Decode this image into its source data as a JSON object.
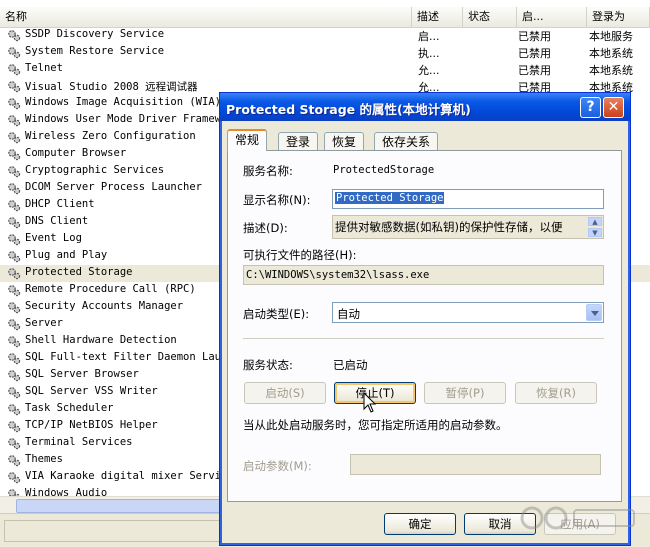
{
  "columns": {
    "name": "名称",
    "desc": "描述",
    "status": "状态",
    "startup": "启...",
    "logon": "登录为"
  },
  "services": [
    {
      "name": "SSDP Discovery Service",
      "desc": "启...",
      "status": "",
      "startup": "已禁用",
      "logon": "本地服务"
    },
    {
      "name": "System Restore Service",
      "desc": "执...",
      "status": "",
      "startup": "已禁用",
      "logon": "本地系统"
    },
    {
      "name": "Telnet",
      "desc": "允...",
      "status": "",
      "startup": "已禁用",
      "logon": "本地系统"
    },
    {
      "name": "Visual Studio 2008 远程调试器",
      "desc": "允...",
      "status": "",
      "startup": "已禁用",
      "logon": "本地系统"
    },
    {
      "name": "Windows Image Acquisition (WIA)",
      "desc": "",
      "status": "",
      "startup": "",
      "logon": ""
    },
    {
      "name": "Windows User Mode Driver Framework",
      "desc": "",
      "status": "",
      "startup": "",
      "logon": ""
    },
    {
      "name": "Wireless Zero Configuration",
      "desc": "",
      "status": "",
      "startup": "",
      "logon": ""
    },
    {
      "name": "Computer Browser",
      "desc": "",
      "status": "",
      "startup": "",
      "logon": ""
    },
    {
      "name": "Cryptographic Services",
      "desc": "",
      "status": "",
      "startup": "",
      "logon": ""
    },
    {
      "name": "DCOM Server Process Launcher",
      "desc": "",
      "status": "",
      "startup": "",
      "logon": ""
    },
    {
      "name": "DHCP Client",
      "desc": "",
      "status": "",
      "startup": "",
      "logon": ""
    },
    {
      "name": "DNS Client",
      "desc": "",
      "status": "",
      "startup": "",
      "logon": ""
    },
    {
      "name": "Event Log",
      "desc": "",
      "status": "",
      "startup": "",
      "logon": ""
    },
    {
      "name": "Plug and Play",
      "desc": "",
      "status": "",
      "startup": "",
      "logon": ""
    },
    {
      "name": "Protected Storage",
      "desc": "",
      "status": "",
      "startup": "",
      "logon": "",
      "selected": true
    },
    {
      "name": "Remote Procedure Call (RPC)",
      "desc": "",
      "status": "",
      "startup": "",
      "logon": ""
    },
    {
      "name": "Security Accounts Manager",
      "desc": "",
      "status": "",
      "startup": "",
      "logon": ""
    },
    {
      "name": "Server",
      "desc": "",
      "status": "",
      "startup": "",
      "logon": ""
    },
    {
      "name": "Shell Hardware Detection",
      "desc": "",
      "status": "",
      "startup": "",
      "logon": ""
    },
    {
      "name": "SQL Full-text Filter Daemon Launcher",
      "desc": "",
      "status": "",
      "startup": "",
      "logon": ""
    },
    {
      "name": "SQL Server Browser",
      "desc": "",
      "status": "",
      "startup": "",
      "logon": ""
    },
    {
      "name": "SQL Server VSS Writer",
      "desc": "",
      "status": "",
      "startup": "",
      "logon": ""
    },
    {
      "name": "Task Scheduler",
      "desc": "",
      "status": "",
      "startup": "",
      "logon": ""
    },
    {
      "name": "TCP/IP NetBIOS Helper",
      "desc": "",
      "status": "",
      "startup": "",
      "logon": ""
    },
    {
      "name": "Terminal Services",
      "desc": "",
      "status": "",
      "startup": "",
      "logon": ""
    },
    {
      "name": "Themes",
      "desc": "",
      "status": "",
      "startup": "",
      "logon": ""
    },
    {
      "name": "VIA Karaoke digital mixer Service",
      "desc": "",
      "status": "",
      "startup": "",
      "logon": ""
    },
    {
      "name": "Windows Audio",
      "desc": "",
      "status": "",
      "startup": "",
      "logon": ""
    }
  ],
  "dialog": {
    "title": "Protected Storage 的属性(本地计算机)",
    "help_glyph": "?",
    "close_glyph": "✕",
    "tabs": [
      "常规",
      "登录",
      "恢复",
      "依存关系"
    ],
    "service_name_label": "服务名称:",
    "service_name": "ProtectedStorage",
    "display_name_label": "显示名称(N):",
    "display_name": "Protected Storage",
    "description_label": "描述(D):",
    "description": "提供对敏感数据(如私钥)的保护性存储，以便",
    "exe_path_label": "可执行文件的路径(H):",
    "exe_path": "C:\\WINDOWS\\system32\\lsass.exe",
    "startup_type_label": "启动类型(E):",
    "startup_type": "自动",
    "service_status_label": "服务状态:",
    "service_status": "已启动",
    "btn_start": "启动(S)",
    "btn_stop": "停止(T)",
    "btn_pause": "暂停(P)",
    "btn_resume": "恢复(R)",
    "hint": "当从此处启动服务时，您可指定所适用的启动参数。",
    "start_params_label": "启动参数(M):",
    "btn_ok": "确定",
    "btn_cancel": "取消",
    "btn_apply": "应用(A)"
  },
  "colors": {
    "titlebar": "#0a58e6",
    "dialog_bg": "#ece9d8",
    "selection": "#316ac5"
  }
}
